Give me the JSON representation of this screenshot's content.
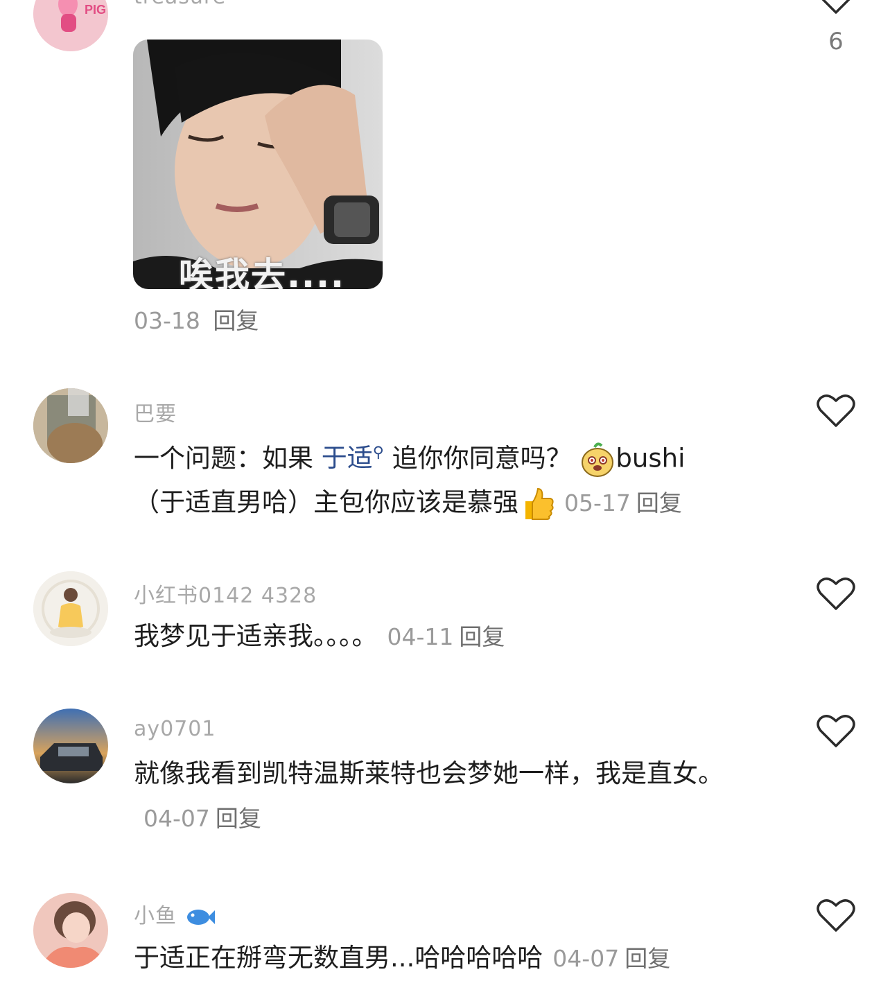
{
  "comments": [
    {
      "username": "treasure",
      "image_caption": "唉我去....",
      "date": "03-18",
      "reply_label": "回复",
      "likes": "6"
    },
    {
      "username": "巴要",
      "text_parts": [
        "一个问题：如果 ",
        "于适",
        " 追你你同意吗？",
        "bushi",
        "（于适直男哈）主包你应该是慕强"
      ],
      "date": "05-17",
      "reply_label": "回复"
    },
    {
      "username": "小红书0142 4328",
      "text": "我梦见于适亲我。。。。",
      "date": "04-11",
      "reply_label": "回复"
    },
    {
      "username": "ay0701",
      "text": "就像我看到凯特温斯莱特也会梦她一样，我是直女。",
      "date": "04-07",
      "reply_label": "回复"
    },
    {
      "username": "小鱼",
      "text": "于适正在掰弯无数直男...哈哈哈哈哈",
      "date": "04-07",
      "reply_label": "回复"
    }
  ],
  "icons": {
    "like": "heart-outline-icon",
    "mention_search": "search-icon",
    "emoji_dog": "dog-face-emoji-icon",
    "emoji_thumbs": "thumbs-up-emoji-icon",
    "emoji_fish": "fish-emoji-icon"
  },
  "colors": {
    "mention": "#2b4c8c",
    "meta": "#9a9a9a",
    "text": "#1e1e1e"
  }
}
